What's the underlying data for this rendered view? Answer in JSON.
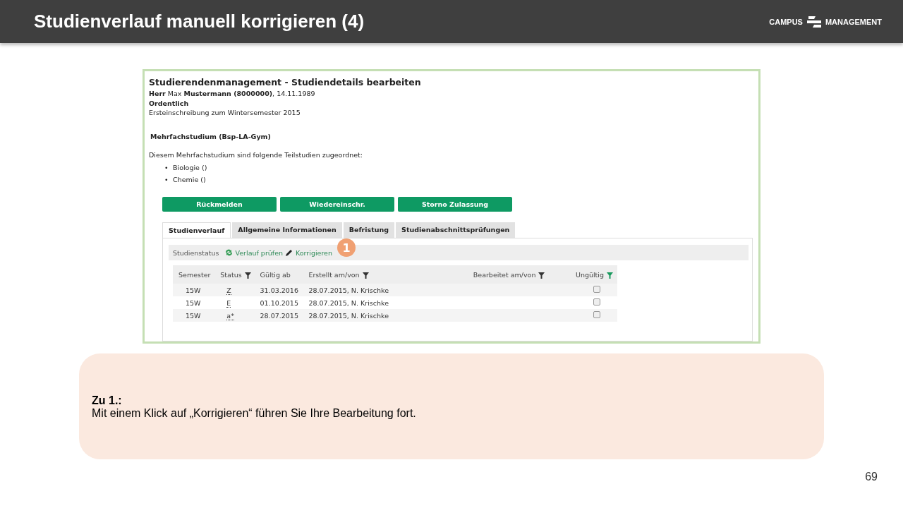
{
  "header": {
    "title": "Studienverlauf manuell korrigieren (4)",
    "logo_left": "CAMPUS",
    "logo_right": "MANAGEMENT"
  },
  "screenshot": {
    "heading": "Studierendenmanagement - Studiendetails bearbeiten",
    "person": "**Herr** Max **Mustermann (8000000)**, 14.11.1989",
    "status": "Ordentlich",
    "enrollment": "Ersteinschreibung zum Wintersemester 2015",
    "program": "Mehrfachstudium (Bsp-LA-Gym)",
    "intro": "Diesem Mehrfachstudium sind folgende Teilstudien zugeordnet:",
    "subjects": [
      {
        "bullet": "•",
        "label": "Biologie ()"
      },
      {
        "bullet": "•",
        "label": "Chemie ()"
      }
    ],
    "buttons": [
      "Rückmelden",
      "Wiedereinschr.",
      "Storno Zulassung"
    ],
    "tabs": [
      {
        "label": "Studienverlauf",
        "selected": true
      },
      {
        "label": "Allgemeine Informationen",
        "selected": false
      },
      {
        "label": "Befristung",
        "selected": false
      },
      {
        "label": "Studienabschnittsprüfungen",
        "selected": false
      }
    ],
    "toolbar": {
      "label": "Studienstatus",
      "check_link": "Verlauf prüfen",
      "edit_link": "Korrigieren",
      "badge": "1"
    },
    "table": {
      "columns": [
        {
          "label": "Semester",
          "kind": "plain"
        },
        {
          "label": "Status",
          "kind": "filter"
        },
        {
          "label": "Gültig ab",
          "kind": "plain"
        },
        {
          "label": "Erstellt am/von",
          "kind": "filter"
        },
        {
          "label": "Bearbeitet am/von",
          "kind": "filter"
        },
        {
          "label": "Ungültig",
          "kind": "filter_active"
        }
      ],
      "rows": [
        {
          "semester": "15W",
          "status": "Z",
          "valid_from": "31.03.2016",
          "created": "28.07.2015, N. Krischke",
          "checked": false
        },
        {
          "semester": "15W",
          "status": "E",
          "valid_from": "01.10.2015",
          "created": "28.07.2015, N. Krischke",
          "checked": false
        },
        {
          "semester": "15W",
          "status": "a*",
          "valid_from": "28.07.2015",
          "created": "28.07.2015, N. Krischke",
          "checked": false
        }
      ]
    }
  },
  "note": {
    "title": "Zu 1.:",
    "text": "Mit einem Klick auf „Korrigieren“ führen Sie Ihre Bearbeitung fort."
  },
  "page_number": "69"
}
